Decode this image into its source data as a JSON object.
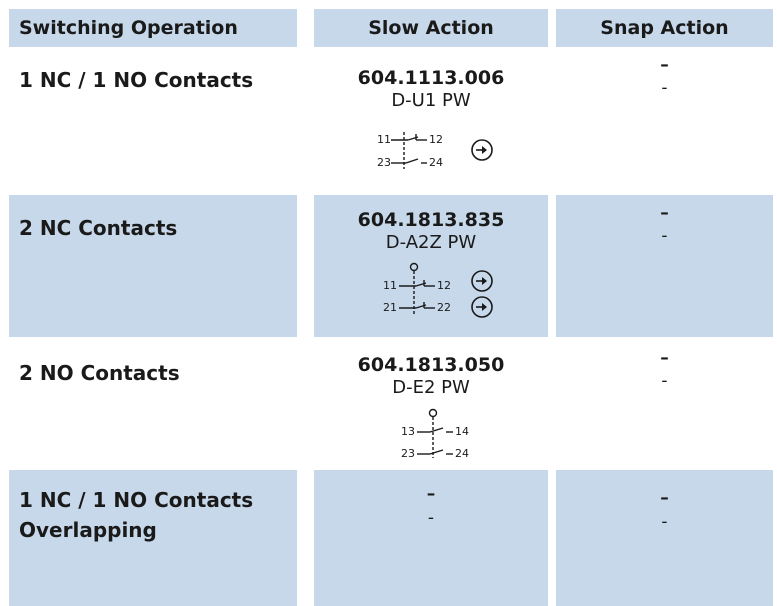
{
  "headers": {
    "operation": "Switching Operation",
    "slow": "Slow Action",
    "snap": "Snap Action"
  },
  "rows": [
    {
      "operation": "1 NC / 1 NO Contacts",
      "slow_code": "604.1113.006",
      "slow_type": "D-U1 PW",
      "terminals": [
        "11",
        "12",
        "23",
        "24"
      ],
      "snap_dash_1": "–",
      "snap_dash_2": "-"
    },
    {
      "operation": "2 NC Contacts",
      "slow_code": "604.1813.835",
      "slow_type": "D-A2Z PW",
      "terminals": [
        "11",
        "12",
        "21",
        "22"
      ],
      "snap_dash_1": "–",
      "snap_dash_2": "-"
    },
    {
      "operation": "2 NO Contacts",
      "slow_code": "604.1813.050",
      "slow_type": "D-E2 PW",
      "terminals": [
        "13",
        "14",
        "23",
        "24"
      ],
      "snap_dash_1": "–",
      "snap_dash_2": "-"
    },
    {
      "operation_line1": "1 NC / 1 NO Contacts",
      "operation_line2": "Overlapping",
      "slow_dash_1": "–",
      "slow_dash_2": "-",
      "snap_dash_1": "–",
      "snap_dash_2": "-"
    }
  ],
  "icons": {
    "positive_opening": "positive-opening-arrow-icon",
    "actuator": "plunger-actuator-icon"
  },
  "colors": {
    "header_bg": "#c6d8ea",
    "shade_bg": "#c6d8ea",
    "text": "#1a1a1a"
  }
}
